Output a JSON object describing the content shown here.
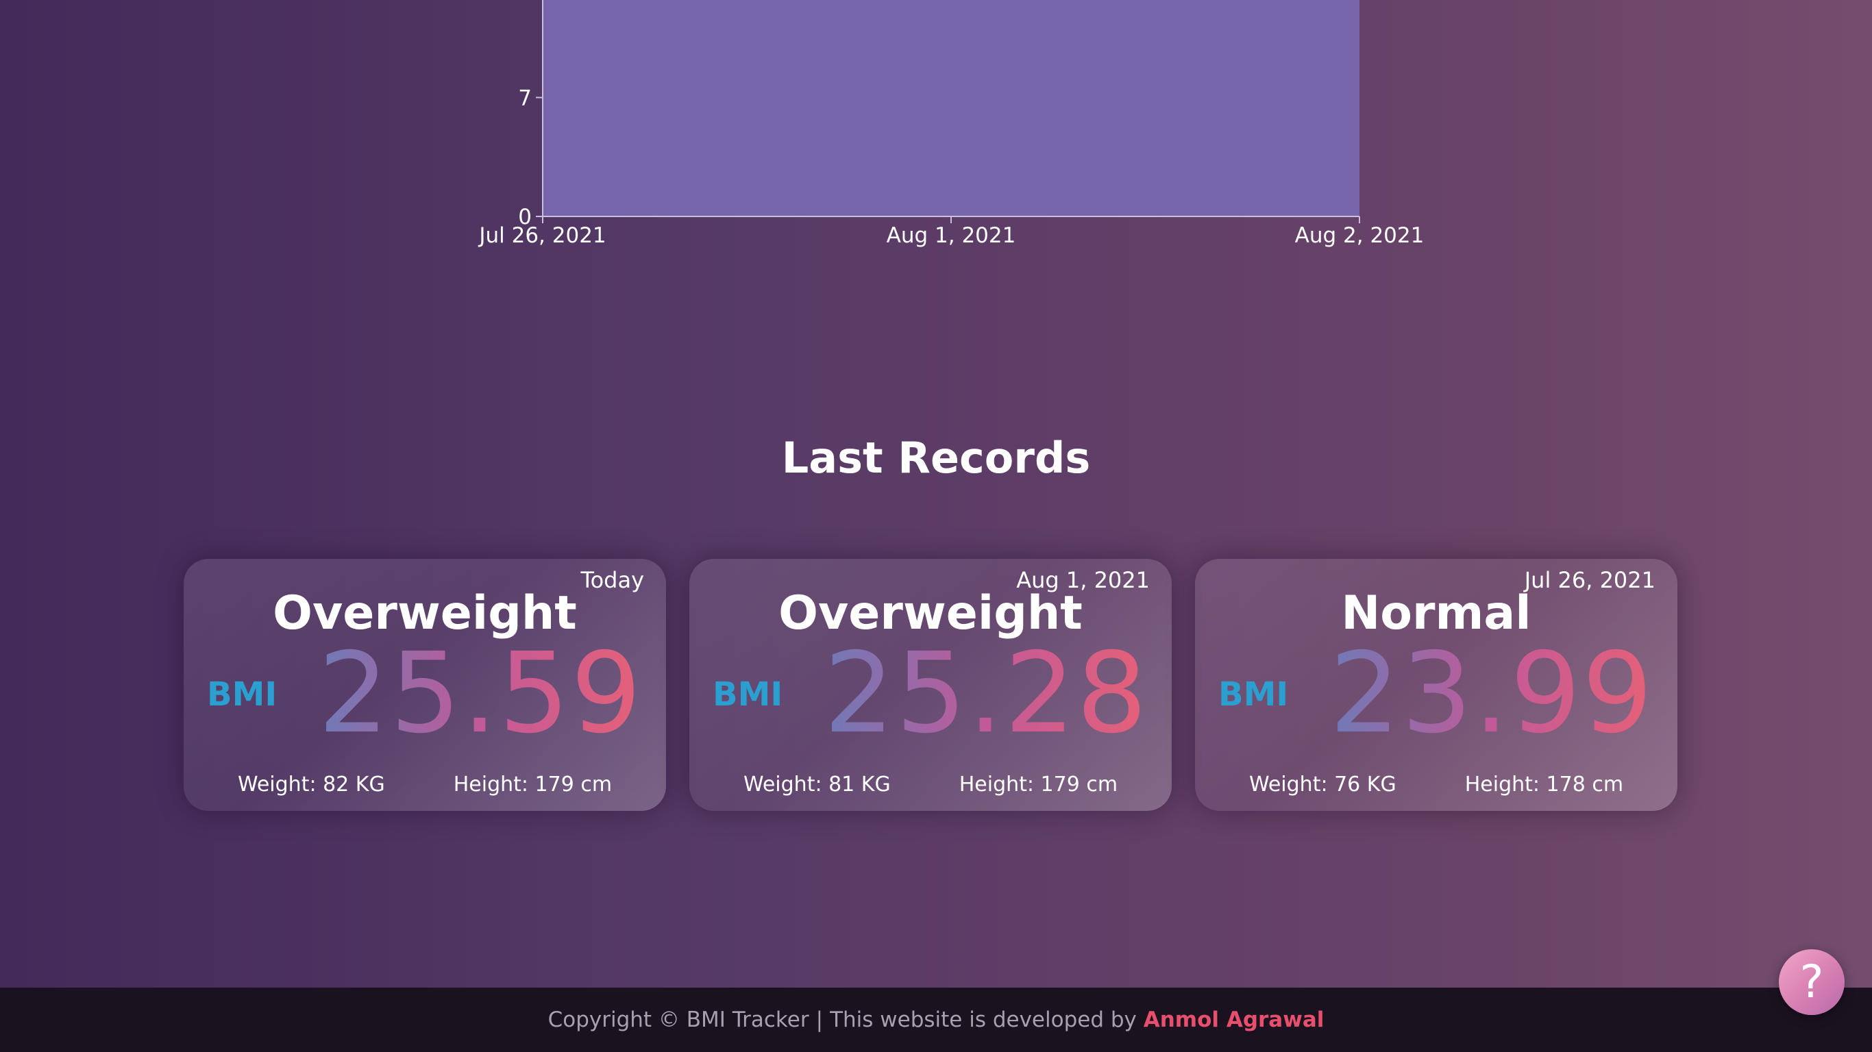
{
  "chart": {
    "chart_data": {
      "type": "area",
      "x": [
        "Jul 26, 2021",
        "Aug 1, 2021",
        "Aug 2, 2021"
      ],
      "x_ticks": [
        "Jul 26, 2021",
        "Aug 1, 2021",
        "Aug 2, 2021"
      ],
      "y_ticks": [
        "0",
        "7"
      ],
      "ylim": [
        0,
        14
      ],
      "series": [
        {
          "values": [
            14,
            14,
            14
          ],
          "color": "#7766ab"
        }
      ],
      "grid": false,
      "axis_color": "#c8c0dc"
    }
  },
  "records": {
    "title": "Last Records",
    "bmi_label": "BMI",
    "items": [
      {
        "date": "Today",
        "category": "Overweight",
        "bmi": "25.59",
        "weight": "Weight: 82 KG",
        "height": "Height: 179 cm"
      },
      {
        "date": "Aug 1, 2021",
        "category": "Overweight",
        "bmi": "25.28",
        "weight": "Weight: 81 KG",
        "height": "Height: 179 cm"
      },
      {
        "date": "Jul 26, 2021",
        "category": "Normal",
        "bmi": "23.99",
        "weight": "Weight: 76 KG",
        "height": "Height: 178 cm"
      }
    ]
  },
  "help": {
    "label": "?",
    "icon": "question-mark-icon"
  },
  "footer": {
    "copyright": "Copyright © BMI Tracker",
    "separator": "|",
    "developed_by": "This website is developed by",
    "author": "Anmol Agrawal"
  },
  "colors": {
    "bmi_label": "#2a9fd0",
    "bmi_gradient_start": "#6e7ab7",
    "bmi_gradient_end": "#e56178",
    "author_link": "#e84f6d"
  }
}
